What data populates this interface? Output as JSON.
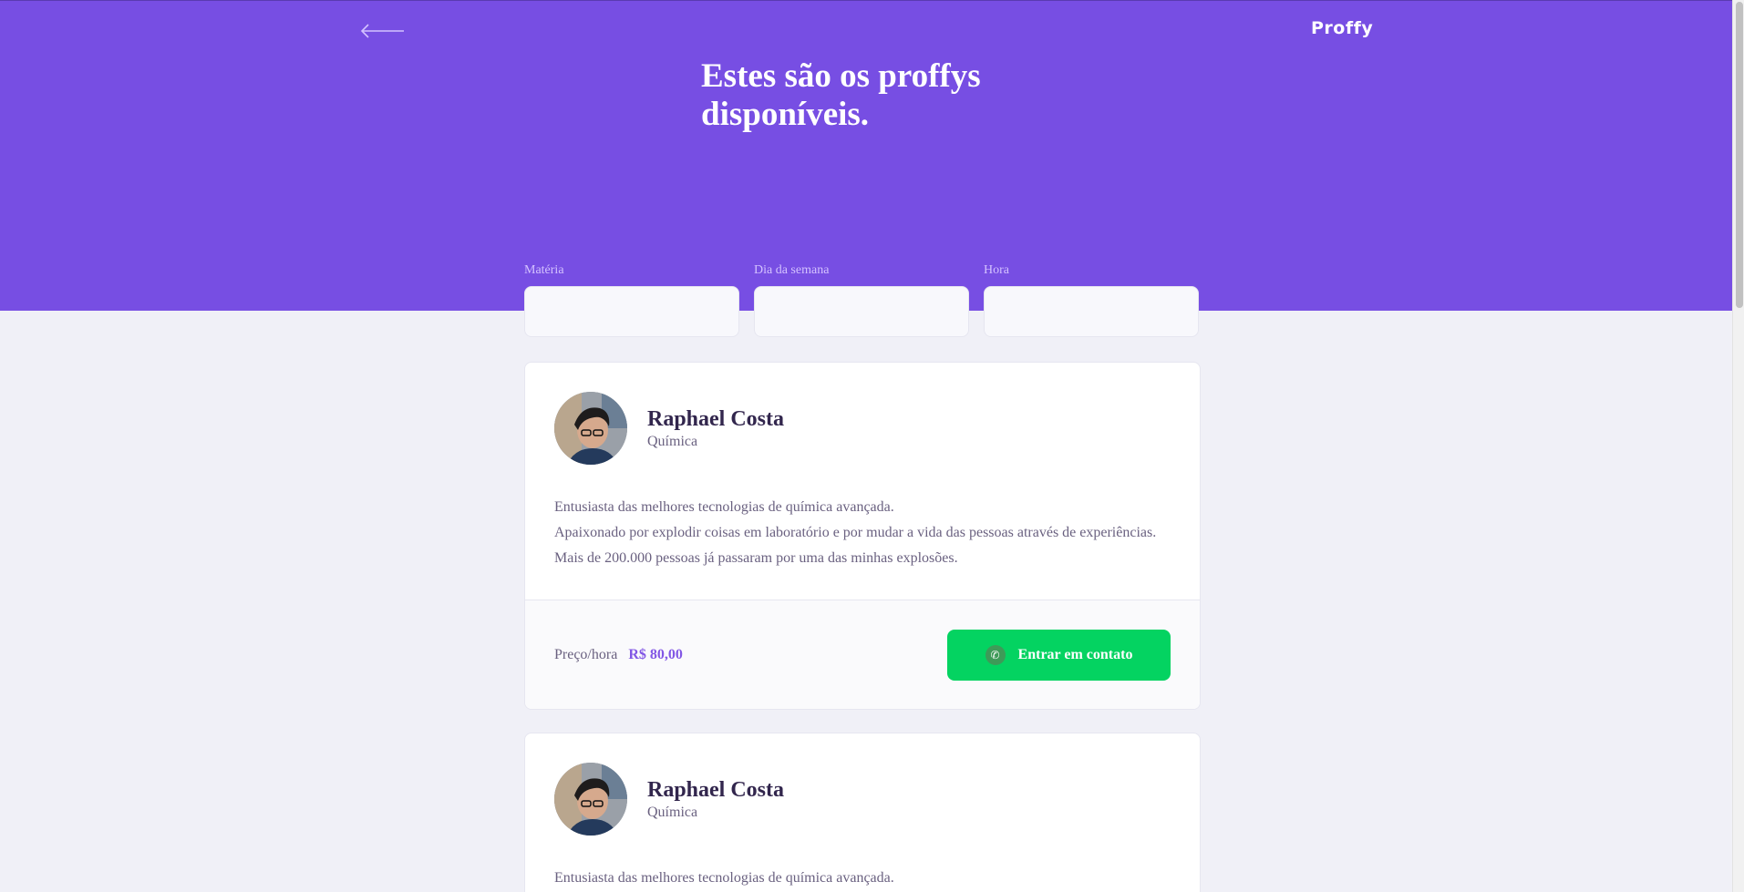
{
  "header": {
    "logo": "Proffy",
    "title": "Estes são os proffys disponíveis.",
    "back_icon": "arrow-left-icon"
  },
  "filters": {
    "subject_label": "Matéria",
    "subject_value": "",
    "weekday_label": "Dia da semana",
    "weekday_value": "",
    "time_label": "Hora",
    "time_value": ""
  },
  "teachers": [
    {
      "name": "Raphael Costa",
      "subject": "Química",
      "bio": [
        "Entusiasta das melhores tecnologias de química avançada.",
        "Apaixonado por explodir coisas em laboratório e por mudar a vida das pessoas através de experiências.",
        "Mais de 200.000 pessoas já passaram por uma das minhas explosões."
      ],
      "price_label": "Preço/hora",
      "price_value": "R$ 80,00",
      "contact_label": "Entrar em contato"
    },
    {
      "name": "Raphael Costa",
      "subject": "Química",
      "bio": [
        "Entusiasta das melhores tecnologias de química avançada."
      ]
    }
  ],
  "colors": {
    "primary": "#774ee3",
    "accent_price": "#8257e5",
    "contact_button": "#04d361",
    "background": "#f0f0f7",
    "title_text": "#32264d",
    "body_text": "#6a6180"
  }
}
